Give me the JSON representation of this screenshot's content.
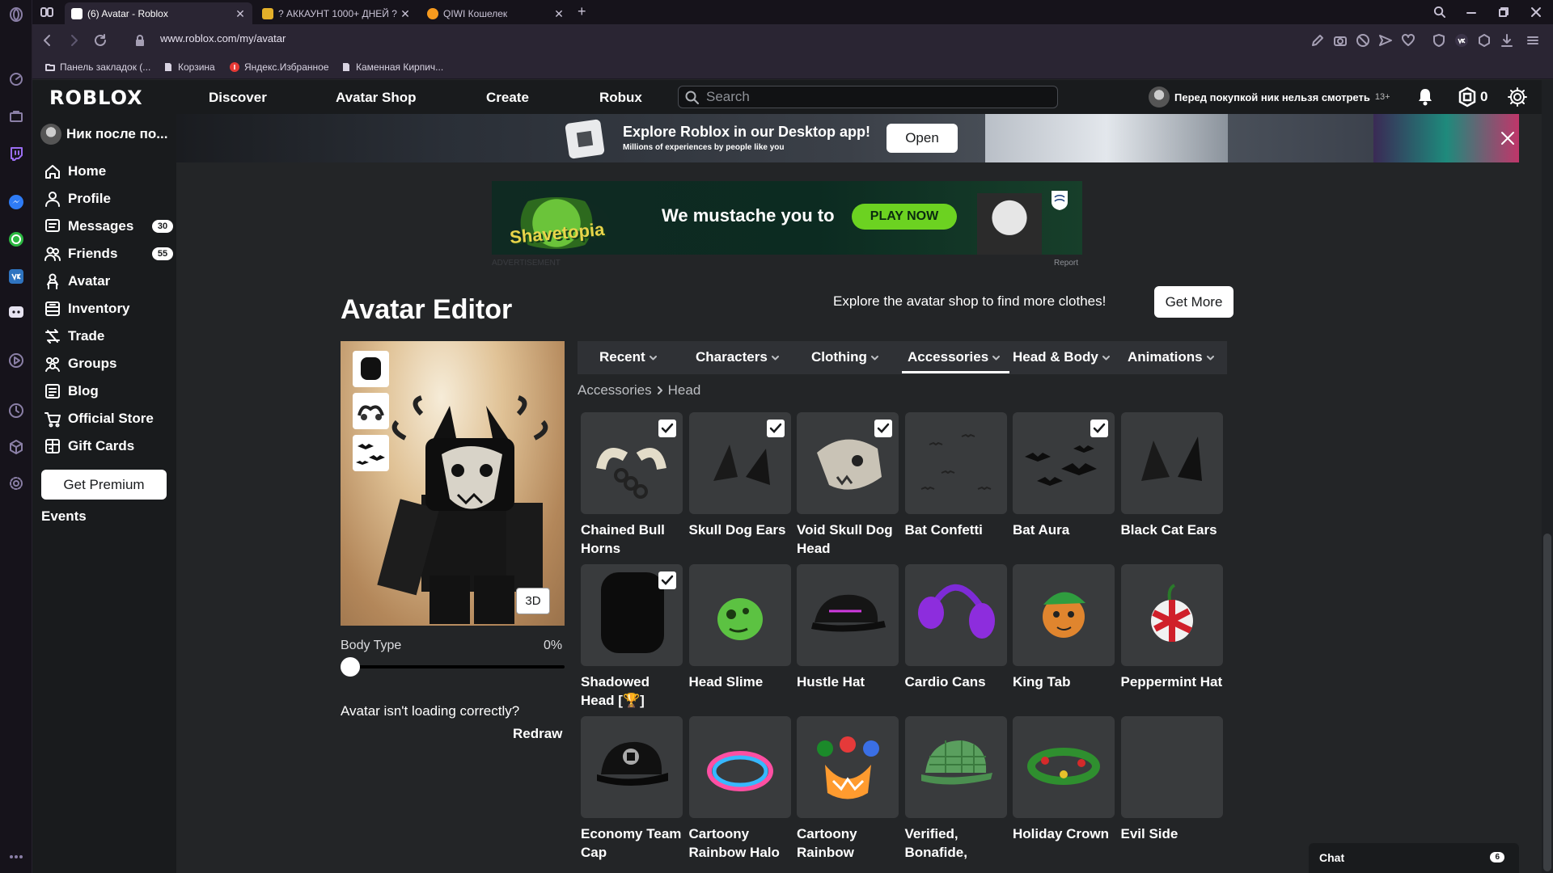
{
  "browser": {
    "tabs": [
      {
        "title": "(6) Avatar - Roblox",
        "active": true
      },
      {
        "title": "? АККАУНТ 1000+ ДНЕЙ ?",
        "active": false
      },
      {
        "title": "QIWI Кошелек",
        "active": false
      }
    ],
    "url": "www.roblox.com/my/avatar",
    "bookmarks": [
      "Панель закладок (...",
      "Корзина",
      "Яндекс.Избранное",
      "Каменная Кирпич..."
    ]
  },
  "header": {
    "logo": "ROBLOX",
    "nav": [
      "Discover",
      "Avatar Shop",
      "Create",
      "Robux"
    ],
    "search_placeholder": "Search",
    "username": "Перед покупкой ник нельзя смотреть",
    "age": "13+",
    "robux": "0"
  },
  "leftnav": {
    "user": "Ник после по...",
    "items": [
      {
        "label": "Home",
        "icon": "home-icon"
      },
      {
        "label": "Profile",
        "icon": "profile-icon"
      },
      {
        "label": "Messages",
        "icon": "messages-icon",
        "count": "30"
      },
      {
        "label": "Friends",
        "icon": "friends-icon",
        "count": "55"
      },
      {
        "label": "Avatar",
        "icon": "avatar-icon"
      },
      {
        "label": "Inventory",
        "icon": "inventory-icon"
      },
      {
        "label": "Trade",
        "icon": "trade-icon"
      },
      {
        "label": "Groups",
        "icon": "groups-icon"
      },
      {
        "label": "Blog",
        "icon": "blog-icon"
      },
      {
        "label": "Official Store",
        "icon": "store-icon"
      },
      {
        "label": "Gift Cards",
        "icon": "gift-card-icon"
      }
    ],
    "premium_button": "Get Premium",
    "events": "Events"
  },
  "banner": {
    "title": "Explore Roblox in our Desktop app!",
    "subtitle": "Millions of experiences by people like you",
    "open_button": "Open"
  },
  "ad": {
    "brand": "Shavetopia",
    "text": "We mustache you to",
    "button": "PLAY NOW",
    "label": "ADVERTISEMENT",
    "report": "Report"
  },
  "editor": {
    "title": "Avatar Editor",
    "promo": "Explore the avatar shop to find more clothes!",
    "get_more": "Get More",
    "button_3d": "3D",
    "body_type_label": "Body Type",
    "body_type_value": "0%",
    "body_type_fraction": 0,
    "loading_question": "Avatar isn't loading correctly?",
    "redraw": "Redraw",
    "tabs": [
      {
        "label": "Recent"
      },
      {
        "label": "Characters"
      },
      {
        "label": "Clothing"
      },
      {
        "label": "Accessories",
        "active": true
      },
      {
        "label": "Head & Body"
      },
      {
        "label": "Animations"
      }
    ],
    "breadcrumb": {
      "parent": "Accessories",
      "current": "Head"
    },
    "items": [
      {
        "name": "Chained Bull Horns",
        "checked": true
      },
      {
        "name": "Skull Dog Ears",
        "checked": true
      },
      {
        "name": "Void Skull Dog Head",
        "checked": true
      },
      {
        "name": "Bat Confetti",
        "checked": false
      },
      {
        "name": "Bat Aura",
        "checked": true
      },
      {
        "name": "Black Cat Ears",
        "checked": false
      },
      {
        "name": "Shadowed Head [🏆]",
        "checked": true
      },
      {
        "name": "Head Slime",
        "checked": false
      },
      {
        "name": "Hustle Hat",
        "checked": false
      },
      {
        "name": "Cardio Cans",
        "checked": false
      },
      {
        "name": "King Tab",
        "checked": false
      },
      {
        "name": "Peppermint Hat",
        "checked": false
      },
      {
        "name": "Economy Team Cap",
        "checked": false
      },
      {
        "name": "Cartoony Rainbow Halo",
        "checked": false
      },
      {
        "name": "Cartoony Rainbow",
        "checked": false
      },
      {
        "name": "Verified, Bonafide,",
        "checked": false
      },
      {
        "name": "Holiday Crown",
        "checked": false
      },
      {
        "name": "Evil Side",
        "checked": false
      }
    ]
  },
  "chat": {
    "label": "Chat",
    "count": "6"
  }
}
